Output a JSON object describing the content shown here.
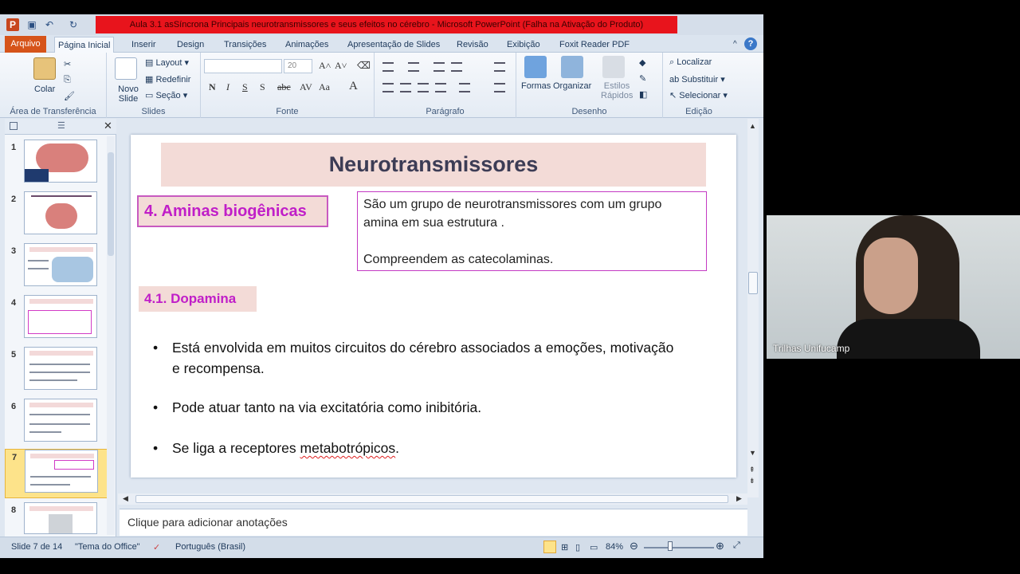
{
  "window": {
    "title": "Aula 3.1 asSíncrona Principais neurotransmissores e seus efeitos no cérebro  -  Microsoft PowerPoint (Falha na Ativação do Produto)"
  },
  "menu": {
    "file": "Arquivo",
    "tabs": [
      "Página Inicial",
      "Inserir",
      "Design",
      "Transições",
      "Animações",
      "Apresentação de Slides",
      "Revisão",
      "Exibição",
      "Foxit Reader PDF"
    ]
  },
  "ribbon": {
    "clipboard": {
      "paste": "Colar",
      "label": "Área de Transferência"
    },
    "slides": {
      "new_slide": "Novo Slide",
      "layout": "Layout",
      "reset": "Redefinir",
      "section": "Seção",
      "label": "Slides"
    },
    "font": {
      "size": "20",
      "label": "Fonte"
    },
    "paragraph": {
      "label": "Parágrafo"
    },
    "drawing": {
      "shapes": "Formas",
      "arrange": "Organizar",
      "quick_styles": "Estilos Rápidos",
      "label": "Desenho"
    },
    "editing": {
      "find": "Localizar",
      "replace": "Substituir",
      "select": "Selecionar",
      "label": "Edição"
    }
  },
  "thumbnails": [
    "1",
    "2",
    "3",
    "4",
    "5",
    "6",
    "7",
    "8"
  ],
  "slide": {
    "title": "Neurotransmissores",
    "section_heading": "4. Aminas biogênicas",
    "info_line1": "São um grupo de neurotransmissores com um grupo",
    "info_line2": "amina em sua estrutura .",
    "info_line3": "Compreendem as catecolaminas.",
    "subheading": "4.1. Dopamina",
    "bullets": [
      {
        "line1": "Está envolvida em muitos circuitos do cérebro associados a emoções, motivação",
        "line2": "e recompensa."
      },
      {
        "line1": "Pode atuar tanto na via excitatória como inibitória."
      },
      {
        "prefix": "Se liga a receptores ",
        "underlined": "metabotrópicos",
        "suffix": "."
      }
    ]
  },
  "notes": {
    "placeholder": "Clique para adicionar anotações"
  },
  "status": {
    "slide_of": "Slide 7 de 14",
    "theme": "\"Tema do Office\"",
    "language": "Português (Brasil)",
    "zoom": "84%"
  },
  "webcam": {
    "name": "Trilhas Unifucamp"
  },
  "colors": {
    "accent": "#c01ec8",
    "title_bar": "#f3dbd7",
    "activation_bar": "#e8141c"
  }
}
